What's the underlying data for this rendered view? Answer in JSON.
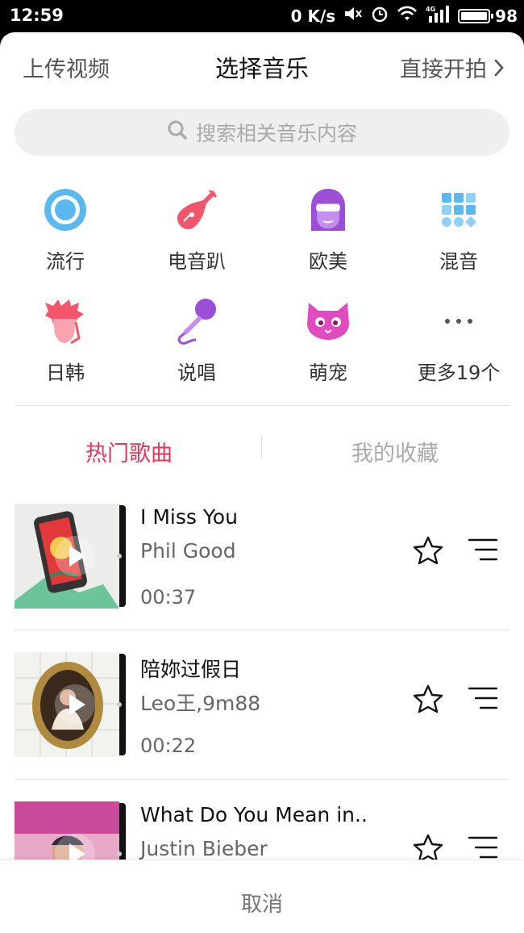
{
  "status_bar": {
    "time": "12:59",
    "net_speed": "0 K/s",
    "network": "4G",
    "battery_level": "98"
  },
  "header": {
    "upload_label": "上传视频",
    "title": "选择音乐",
    "shoot_label": "直接开拍"
  },
  "search": {
    "placeholder": "搜索相关音乐内容"
  },
  "categories": [
    {
      "label": "流行",
      "icon": "disc-icon"
    },
    {
      "label": "电音趴",
      "icon": "guitar-icon"
    },
    {
      "label": "欧美",
      "icon": "face-sunglasses-icon"
    },
    {
      "label": "混音",
      "icon": "grid-dots-icon"
    },
    {
      "label": "日韩",
      "icon": "spiky-hair-icon"
    },
    {
      "label": "说唱",
      "icon": "microphone-icon"
    },
    {
      "label": "萌宠",
      "icon": "cat-icon"
    },
    {
      "label": "更多19个",
      "icon": "more-dots-icon"
    }
  ],
  "tabs": {
    "hot": "热门歌曲",
    "favorites": "我的收藏"
  },
  "songs": [
    {
      "title": "I Miss You",
      "artist": "Phil Good",
      "duration": "00:37"
    },
    {
      "title": "陪妳过假日",
      "artist": "Leo王,9m88",
      "duration": "00:22"
    },
    {
      "title": "What Do You Mean in..",
      "artist": "Justin Bieber",
      "duration": ""
    }
  ],
  "footer": {
    "cancel_label": "取消"
  },
  "colors": {
    "accent": "#e0375d",
    "cat_blue": "#5ab8ef",
    "cat_pink": "#f2566c",
    "cat_purple": "#9a4fd6",
    "cat_magenta": "#e04bc0"
  }
}
